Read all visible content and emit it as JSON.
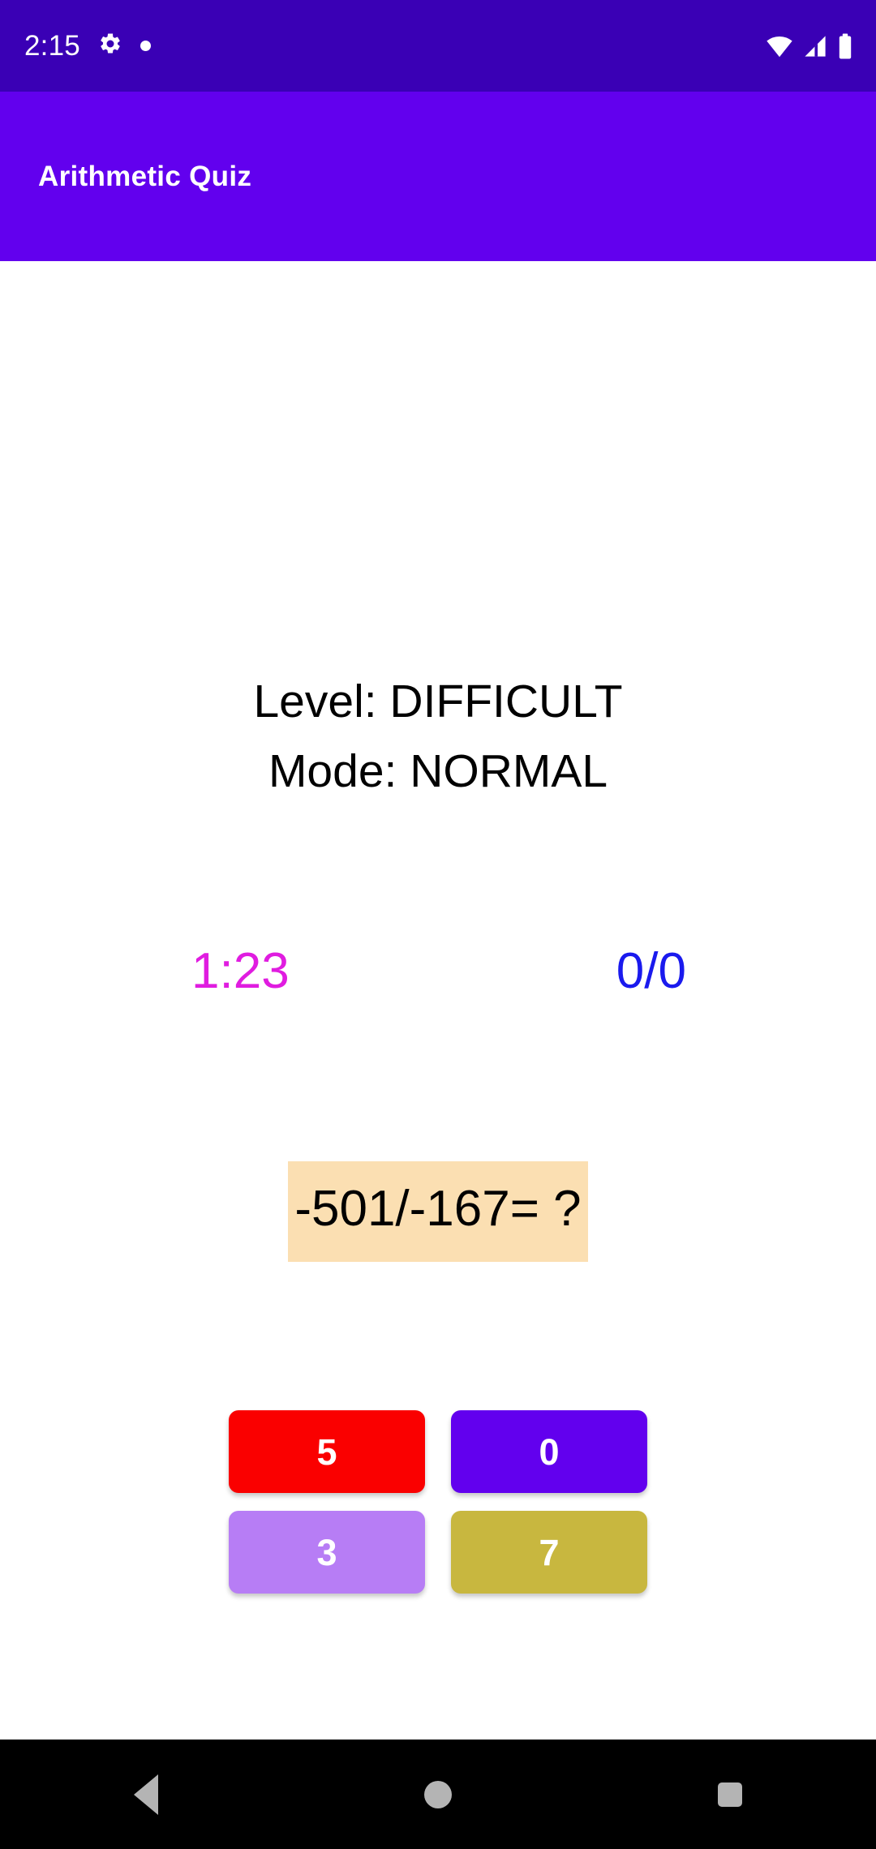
{
  "status_bar": {
    "clock": "2:15",
    "icons": [
      "gear-icon",
      "dot-icon",
      "wifi-icon",
      "cellular-signal-icon",
      "battery-icon"
    ],
    "background_color": "#3a00b5"
  },
  "app_bar": {
    "title": "Arithmetic Quiz",
    "background_color": "#6200ee",
    "text_color": "#ffffff"
  },
  "game": {
    "level_line": "Level: DIFFICULT",
    "mode_line": "Mode: NORMAL",
    "level_value": "DIFFICULT",
    "mode_value": "NORMAL",
    "timer": "1:23",
    "timer_color": "#e01ce0",
    "score": "0/0",
    "score_color": "#1a1aee",
    "question": "-501/-167= ?",
    "question_background": "#fbdfb2",
    "answers": [
      {
        "label": "5",
        "color": "#fa0000"
      },
      {
        "label": "0",
        "color": "#6200ee"
      },
      {
        "label": "3",
        "color": "#b77df5"
      },
      {
        "label": "7",
        "color": "#c8b73f"
      }
    ]
  },
  "nav_bar": {
    "back_label": "Back",
    "home_label": "Home",
    "recents_label": "Recents",
    "background_color": "#000000"
  }
}
